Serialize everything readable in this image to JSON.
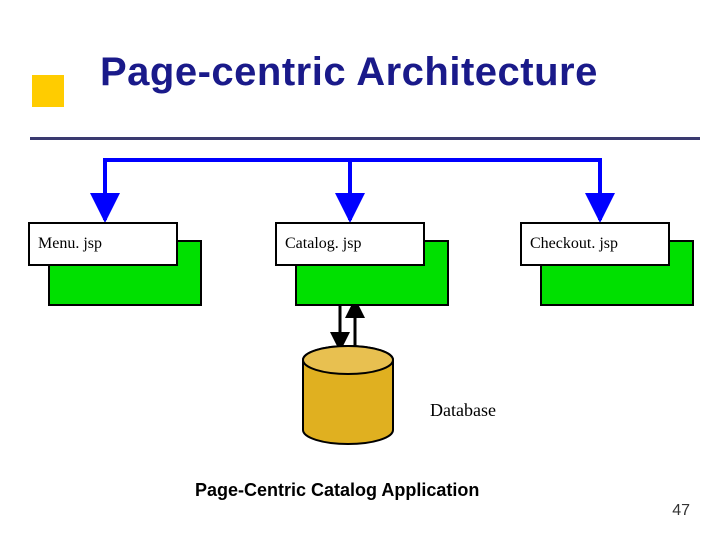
{
  "slide": {
    "title": "Page-centric Architecture",
    "caption": "Page-Centric Catalog Application",
    "page_number": "47"
  },
  "nodes": {
    "menu": "Menu. jsp",
    "catalog": "Catalog. jsp",
    "checkout": "Checkout. jsp",
    "database": "Database"
  }
}
